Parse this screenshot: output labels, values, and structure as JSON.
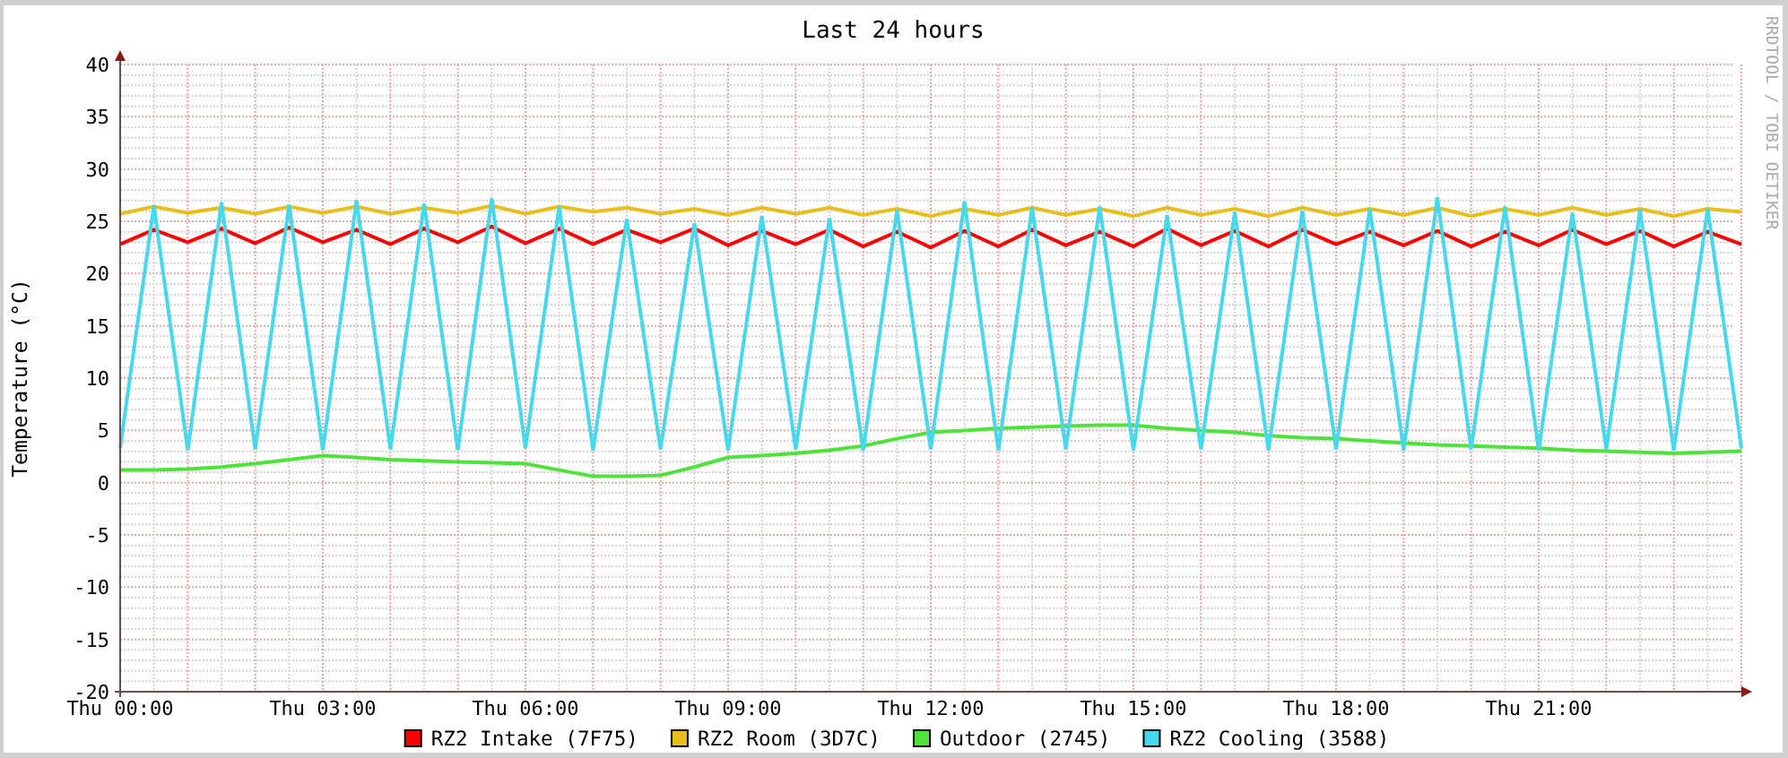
{
  "chart": {
    "side_note": "RRDTOOL / TOBI OETIKER",
    "chart_data": {
      "type": "line",
      "title": "Last 24 hours",
      "ylabel": "Temperature (°C)",
      "categories": [
        "Thu 00:00",
        null,
        null,
        null,
        null,
        null,
        "Thu 03:00",
        null,
        null,
        null,
        null,
        null,
        "Thu 06:00",
        null,
        null,
        null,
        null,
        null,
        "Thu 09:00",
        null,
        null,
        null,
        null,
        null,
        "Thu 12:00",
        null,
        null,
        null,
        null,
        null,
        "Thu 15:00",
        null,
        null,
        null,
        null,
        null,
        "Thu 18:00",
        null,
        null,
        null,
        null,
        null,
        "Thu 21:00",
        null,
        null,
        null,
        null,
        null,
        null
      ],
      "ylim": [
        -20,
        40
      ],
      "grid": true,
      "legend": true,
      "yticks": [
        -20,
        -15,
        -10,
        -5,
        0,
        5,
        10,
        15,
        20,
        25,
        30,
        35,
        40
      ],
      "series": [
        {
          "name": "RZ2 Intake (7F75)",
          "color": "#ff0000",
          "values": [
            22.8,
            24.2,
            23,
            24.3,
            22.9,
            24.4,
            23,
            24.2,
            22.8,
            24.3,
            23,
            24.5,
            22.9,
            24.3,
            22.8,
            24.2,
            23,
            24.3,
            22.7,
            24.1,
            22.8,
            24.2,
            22.6,
            24,
            22.5,
            24.1,
            22.6,
            24.2,
            22.7,
            24,
            22.6,
            24.3,
            22.7,
            24.1,
            22.6,
            24.2,
            22.8,
            24,
            22.7,
            24.1,
            22.6,
            24,
            22.7,
            24.2,
            22.8,
            24.1,
            22.6,
            24,
            22.8
          ]
        },
        {
          "name": "RZ2 Room (3D7C)",
          "color": "#e8bf1a",
          "values": [
            25.7,
            26.4,
            25.8,
            26.3,
            25.7,
            26.4,
            25.8,
            26.4,
            25.7,
            26.3,
            25.8,
            26.5,
            25.7,
            26.4,
            25.9,
            26.3,
            25.7,
            26.2,
            25.6,
            26.3,
            25.7,
            26.3,
            25.6,
            26.2,
            25.5,
            26.2,
            25.6,
            26.3,
            25.6,
            26.2,
            25.5,
            26.3,
            25.6,
            26.2,
            25.5,
            26.3,
            25.6,
            26.2,
            25.6,
            26.3,
            25.5,
            26.2,
            25.6,
            26.3,
            25.6,
            26.2,
            25.5,
            26.2,
            25.9
          ]
        },
        {
          "name": "Outdoor (2745)",
          "color": "#4ee23a",
          "values": [
            1.2,
            1.2,
            1.3,
            1.5,
            1.8,
            2.2,
            2.6,
            2.4,
            2.2,
            2.1,
            2,
            1.9,
            1.8,
            1.2,
            0.6,
            0.6,
            0.7,
            1.5,
            2.4,
            2.6,
            2.8,
            3.1,
            3.5,
            4.2,
            4.8,
            5,
            5.2,
            5.3,
            5.4,
            5.5,
            5.5,
            5.2,
            5,
            4.8,
            4.5,
            4.3,
            4.2,
            4,
            3.8,
            3.6,
            3.5,
            3.4,
            3.3,
            3.1,
            3,
            2.9,
            2.8,
            2.9,
            3
          ]
        },
        {
          "name": "RZ2 Cooling (3588)",
          "color": "#45d9eb",
          "values": [
            3.3,
            26.5,
            3.1,
            26.8,
            3.2,
            26.6,
            3.1,
            27,
            3.2,
            26.7,
            3.1,
            27.2,
            3.3,
            26.4,
            3.1,
            25.2,
            3.2,
            24.8,
            3.1,
            25.5,
            3.2,
            25.3,
            3.1,
            26.1,
            3.2,
            26.9,
            3.1,
            26.3,
            3.2,
            26.4,
            3.1,
            25.6,
            3.2,
            25.9,
            3.1,
            26,
            3.2,
            26.2,
            3.1,
            27.3,
            3.2,
            26.4,
            3.1,
            25.8,
            3.2,
            26.1,
            3.1,
            26.2,
            3.3
          ]
        }
      ]
    }
  }
}
